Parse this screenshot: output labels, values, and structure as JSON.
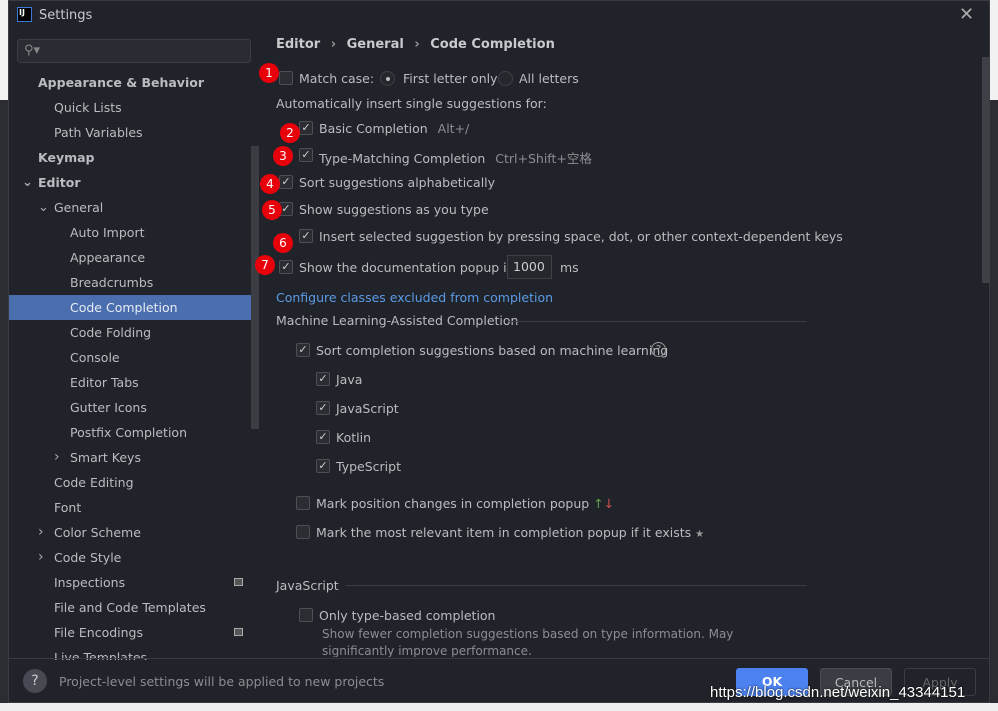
{
  "window": {
    "title": "Settings",
    "logo": "IJ"
  },
  "search": {
    "placeholder": ""
  },
  "sidebar": {
    "items": [
      {
        "label": "Appearance & Behavior",
        "bold": true,
        "indent": 0
      },
      {
        "label": "Quick Lists",
        "indent": 1
      },
      {
        "label": "Path Variables",
        "indent": 1
      },
      {
        "label": "Keymap",
        "bold": true,
        "indent": 0
      },
      {
        "label": "Editor",
        "bold": true,
        "indent": 0,
        "expanded": true
      },
      {
        "label": "General",
        "indent": 1,
        "expanded": true
      },
      {
        "label": "Auto Import",
        "indent": 2
      },
      {
        "label": "Appearance",
        "indent": 2
      },
      {
        "label": "Breadcrumbs",
        "indent": 2
      },
      {
        "label": "Code Completion",
        "indent": 2,
        "selected": true
      },
      {
        "label": "Code Folding",
        "indent": 2
      },
      {
        "label": "Console",
        "indent": 2
      },
      {
        "label": "Editor Tabs",
        "indent": 2
      },
      {
        "label": "Gutter Icons",
        "indent": 2
      },
      {
        "label": "Postfix Completion",
        "indent": 2
      },
      {
        "label": "Smart Keys",
        "indent": 2,
        "collapsed": true
      },
      {
        "label": "Code Editing",
        "indent": 1
      },
      {
        "label": "Font",
        "indent": 1
      },
      {
        "label": "Color Scheme",
        "indent": 1,
        "collapsed": true
      },
      {
        "label": "Code Style",
        "indent": 1,
        "collapsed": true
      },
      {
        "label": "Inspections",
        "indent": 1,
        "project": true
      },
      {
        "label": "File and Code Templates",
        "indent": 1
      },
      {
        "label": "File Encodings",
        "indent": 1,
        "project": true
      },
      {
        "label": "Live Templates",
        "indent": 1
      }
    ]
  },
  "breadcrumb": [
    "Editor",
    "General",
    "Code Completion"
  ],
  "main": {
    "match_case": {
      "label": "Match case:",
      "checked": false,
      "options": [
        "First letter only",
        "All letters"
      ],
      "selected": "First letter only"
    },
    "auto_insert_label": "Automatically insert single suggestions for:",
    "basic": {
      "label": "Basic Completion",
      "shortcut": "Alt+/",
      "checked": true
    },
    "type_matching": {
      "label": "Type-Matching Completion",
      "shortcut": "Ctrl+Shift+空格",
      "checked": true
    },
    "sort_alpha": {
      "label": "Sort suggestions alphabetically",
      "checked": true
    },
    "show_as_type": {
      "label": "Show suggestions as you type",
      "checked": true
    },
    "insert_selected": {
      "label": "Insert selected suggestion by pressing space, dot, or other context-dependent keys",
      "checked": true
    },
    "doc_popup": {
      "label": "Show the documentation popup in",
      "value": "1000",
      "unit": "ms",
      "checked": true
    },
    "configure_link": "Configure classes excluded from completion",
    "ml_section": "Machine Learning-Assisted Completion",
    "ml_sort": {
      "label": "Sort completion suggestions based on machine learning",
      "checked": true
    },
    "ml_langs": [
      {
        "label": "Java",
        "checked": true
      },
      {
        "label": "JavaScript",
        "checked": true
      },
      {
        "label": "Kotlin",
        "checked": true
      },
      {
        "label": "TypeScript",
        "checked": true
      }
    ],
    "mark_position": {
      "label": "Mark position changes in completion popup",
      "checked": false
    },
    "mark_relevant": {
      "label": "Mark the most relevant item in completion popup if it exists",
      "checked": false
    },
    "js_section": "JavaScript",
    "js_only_type": {
      "label": "Only type-based completion",
      "checked": false,
      "desc1": "Show fewer completion suggestions based on type information. May",
      "desc2": "significantly improve performance."
    }
  },
  "annotations": [
    "1",
    "2",
    "3",
    "4",
    "5",
    "6",
    "7"
  ],
  "footer": {
    "help": "?",
    "note": "Project-level settings will be applied to new projects",
    "ok": "OK",
    "cancel": "Cancel",
    "apply": "Apply"
  },
  "watermark": "https://blog.csdn.net/weixin_43344151",
  "colors": {
    "accent": "#4b6eaf",
    "ok": "#4c82f0",
    "badge": "#e8000b",
    "link": "#5b9be6"
  }
}
